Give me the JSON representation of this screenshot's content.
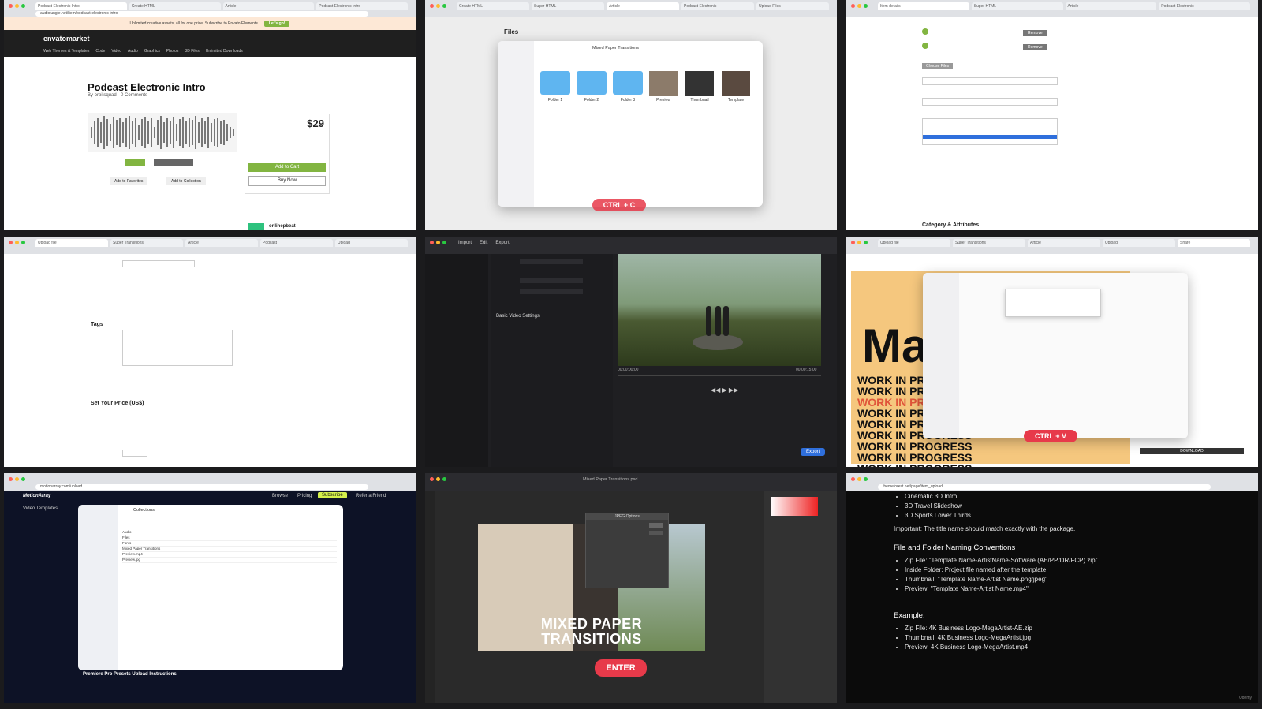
{
  "panel1": {
    "tabs": [
      "Podcast Electronic Intro",
      "Create HTML",
      "Article",
      "Podcast Electronic Intro"
    ],
    "url": "audiojungle.net/item/podcast-electronic-intro",
    "promo_text": "Unlimited creative assets, all for one price. Subscribe to Envato Elements",
    "promo_cta": "Let's go!",
    "logo": "envatomarket",
    "menu": [
      "Web Themes & Templates",
      "Code",
      "Video",
      "Audio",
      "Graphics",
      "Photos",
      "3D Files",
      "Unlimited Downloads"
    ],
    "item_title": "Podcast Electronic Intro",
    "author": "By orbitsquad",
    "comments": "0 Comments",
    "price": "$29",
    "add_to_cart": "Add to Cart",
    "buy_now": "Buy Now",
    "favorites": "Add to Favorites",
    "collection": "Add to Collection",
    "seller": "onlinepbeat"
  },
  "panel2": {
    "tabs": [
      "Create HTML",
      "Super HTML",
      "Article",
      "Podcast Electronic",
      "Upload Files"
    ],
    "heading": "Files",
    "finder_title": "Mixed Paper Transitions",
    "folders": [
      "Folder 1",
      "Folder 2",
      "Folder 3"
    ],
    "thumbs": [
      "Preview",
      "Thumbnail",
      "Template"
    ],
    "keycap": "CTRL + C"
  },
  "panel3": {
    "tabs": [
      "Item details",
      "Super HTML",
      "Article",
      "Podcast Electronic"
    ],
    "remove": "Remove",
    "choose": "Choose Files",
    "heading": "Category & Attributes"
  },
  "panel4": {
    "tabs": [
      "Upload file",
      "Super Transitions",
      "Article",
      "Podcast",
      "Upload"
    ],
    "tags_heading": "Tags",
    "price_heading": "Set Your Price (US$)"
  },
  "panel5": {
    "menu": [
      "Import",
      "Edit",
      "Export"
    ],
    "section": "Basic Video Settings",
    "export_button": "Export",
    "timecode_start": "00;00;00;00",
    "timecode_end": "00;00;15;00"
  },
  "panel6": {
    "tabs": [
      "Upload file",
      "Super Transitions",
      "Article",
      "Upload",
      "Share"
    ],
    "big_text": "Ma",
    "wip_text": "WORK IN PROGRESS",
    "keycap": "CTRL + V",
    "download": "DOWNLOAD"
  },
  "panel7": {
    "url": "motionarray.com/upload",
    "brand": "MotionArray",
    "nav": [
      "Browse",
      "Pricing",
      "Refer a Friend"
    ],
    "cta": "Subscribe",
    "section": "Video Templates",
    "finder_title": "Collections",
    "rows": [
      "Audio",
      "Files",
      "Fonts",
      "Mixed Paper Transitions",
      "Preview.mp4",
      "Preview.jpg"
    ],
    "footer_heading": "Premiere Pro Presets Upload Instructions"
  },
  "panel8": {
    "title": "Mixed Paper Transitions.psd",
    "art_line1": "MIXED PAPER",
    "art_line2": "TRANSITIONS",
    "keycap": "ENTER",
    "dialog_title": "JPEG Options"
  },
  "panel9": {
    "url": "themeforest.net/page/item_upload",
    "list_top": [
      "Cinematic 3D Intro",
      "3D Travel Slideshow",
      "3D Sports Lower Thirds"
    ],
    "important": "Important: The title name should match exactly with the package.",
    "naming_heading": "File and Folder Naming Conventions",
    "naming_items": [
      "Zip File: \"Template Name-ArtistName-Software (AE/PP/DR/FCP).zip\"",
      "Inside Folder: Project file named after the template",
      "Thumbnail: \"Template Name-Artist Name.png/jpeg\"",
      "Preview: \"Template Name-Artist Name.mp4\""
    ],
    "example_heading": "Example:",
    "example_items": [
      "Zip File: 4K Business Logo-MegaArtist-AE.zip",
      "Thumbnail: 4K Business Logo-MegaArtist.jpg",
      "Preview: 4K Business Logo-MegaArtist.mp4"
    ],
    "watermark": "Udemy"
  },
  "colors": {
    "accent_green": "#82b541",
    "keycap_red": "#e73a4a",
    "folder_blue": "#5fb5f0"
  }
}
